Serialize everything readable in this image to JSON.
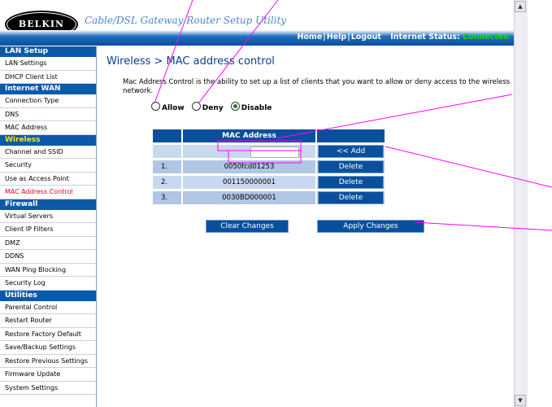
{
  "header": {
    "logo_text": "BELKIN",
    "tagline": "Cable/DSL Gateway Router Setup Utility",
    "links": [
      "Home",
      "Help",
      "Logout"
    ],
    "status_label": "Internet Status:",
    "status_value": "Connected",
    "status_color": "#19e000"
  },
  "sidebar": {
    "sections": [
      {
        "title": "LAN Setup",
        "items": [
          "LAN Settings",
          "DHCP Client List"
        ]
      },
      {
        "title": "Internet WAN",
        "items": [
          "Connection Type",
          "DNS",
          "MAC Address"
        ]
      },
      {
        "title": "Wireless",
        "items": [
          "Channel and SSID",
          "Security",
          "Use as Access Point",
          "MAC Address Control"
        ]
      },
      {
        "title": "Firewall",
        "items": [
          "Virtual Servers",
          "Client IP Filters",
          "DMZ",
          "DDNS",
          "WAN Ping Blocking",
          "Security Log"
        ]
      },
      {
        "title": "Utilities",
        "items": [
          "Parental Control",
          "Restart Router",
          "Restore Factory Default",
          "Save/Backup Settings",
          "Restore Previous Settings",
          "Firmware Update",
          "System Settings"
        ]
      }
    ],
    "active_section": "Wireless",
    "active_item": "MAC Address Control"
  },
  "main": {
    "title": "Wireless > MAC address control",
    "description": "Mac Address Control is the ability to set up a list of clients that you want to allow or deny access to the wireless network.",
    "modes": [
      {
        "label": "Allow",
        "selected": false
      },
      {
        "label": "Deny",
        "selected": false
      },
      {
        "label": "Disable",
        "selected": true
      }
    ],
    "table": {
      "header": "MAC Address",
      "input_value": "",
      "add_label": "<< Add",
      "rows": [
        {
          "num": "1.",
          "mac": "0050fcd01253",
          "action": "Delete"
        },
        {
          "num": "2.",
          "mac": "001150000001",
          "action": "Delete"
        },
        {
          "num": "3.",
          "mac": "0030BD000001",
          "action": "Delete"
        }
      ]
    },
    "clear_label": "Clear Changes",
    "apply_label": "Apply Changes"
  },
  "colors": {
    "nav_blue": "#0b5aaa",
    "active_item": "#e0002a",
    "active_section": "#ffe600",
    "annotation_lines": "#ff00ff"
  },
  "icons": [
    "scroll-up-arrow-icon",
    "scroll-down-arrow-icon",
    "radio-icon"
  ]
}
